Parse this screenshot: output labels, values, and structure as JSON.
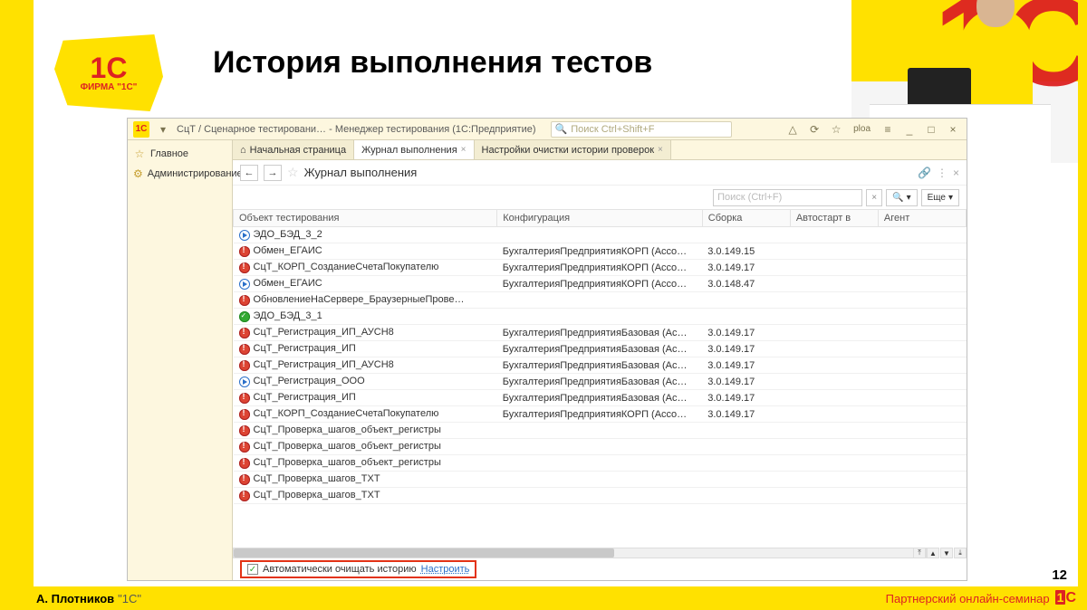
{
  "slide": {
    "title": "История выполнения тестов",
    "number": "12",
    "author_name": "А. Плотников",
    "author_org": "\"1С\"",
    "seminar": "Партнерский онлайн-семинар",
    "logo_text_big": "1С",
    "logo_text_small": "ФИРМА \"1С\""
  },
  "app": {
    "title": "СцТ / Сценарное тестировани…  - Менеджер тестирования (1С:Предприятие)",
    "search_placeholder": "Поиск Ctrl+Shift+F",
    "user_label": "ploa",
    "sidebar": {
      "main": "Главное",
      "admin": "Администрирование"
    },
    "tabs": {
      "start": "Начальная страница",
      "journal": "Журнал выполнения",
      "settings": "Настройки очистки истории проверок"
    },
    "header": {
      "title": "Журнал выполнения",
      "search_placeholder": "Поиск (Ctrl+F)",
      "more_btn": "Еще"
    },
    "columns": {
      "object": "Объект тестирования",
      "config": "Конфигурация",
      "build": "Сборка",
      "autostart": "Автостарт в",
      "agent": "Агент"
    },
    "rows": [
      {
        "status": "play",
        "object": "ЭДО_БЭД_3_2",
        "config": "",
        "build": ""
      },
      {
        "status": "red",
        "object": "Обмен_ЕГАИС",
        "config": "БухгалтерияПредприятияКОРП (Acco…",
        "build": "3.0.149.15"
      },
      {
        "status": "red",
        "object": "СцТ_КОРП_СозданиеСчетаПокупателю",
        "config": "БухгалтерияПредприятияКОРП (Acco…",
        "build": "3.0.149.17"
      },
      {
        "status": "play",
        "object": "Обмен_ЕГАИС",
        "config": "БухгалтерияПредприятияКОРП (Acco…",
        "build": "3.0.148.47"
      },
      {
        "status": "red",
        "object": "ОбновлениеНаСервере_БраузерныеПрове…",
        "config": "",
        "build": ""
      },
      {
        "status": "green",
        "object": "ЭДО_БЭД_3_1",
        "config": "",
        "build": ""
      },
      {
        "status": "red",
        "object": "СцТ_Регистрация_ИП_АУСН8",
        "config": "БухгалтерияПредприятияБазовая (Ac…",
        "build": "3.0.149.17"
      },
      {
        "status": "red",
        "object": "СцТ_Регистрация_ИП",
        "config": "БухгалтерияПредприятияБазовая (Ac…",
        "build": "3.0.149.17"
      },
      {
        "status": "red",
        "object": "СцТ_Регистрация_ИП_АУСН8",
        "config": "БухгалтерияПредприятияБазовая (Ac…",
        "build": "3.0.149.17"
      },
      {
        "status": "play",
        "object": "СцТ_Регистрация_ООО",
        "config": "БухгалтерияПредприятияБазовая (Ac…",
        "build": "3.0.149.17"
      },
      {
        "status": "red",
        "object": "СцТ_Регистрация_ИП",
        "config": "БухгалтерияПредприятияБазовая (Ac…",
        "build": "3.0.149.17"
      },
      {
        "status": "red",
        "object": "СцТ_КОРП_СозданиеСчетаПокупателю",
        "config": "БухгалтерияПредприятияКОРП (Acco…",
        "build": "3.0.149.17"
      },
      {
        "status": "red",
        "object": "СцТ_Проверка_шагов_объект_регистры",
        "config": "",
        "build": ""
      },
      {
        "status": "red",
        "object": "СцТ_Проверка_шагов_объект_регистры",
        "config": "",
        "build": ""
      },
      {
        "status": "red",
        "object": "СцТ_Проверка_шагов_объект_регистры",
        "config": "",
        "build": ""
      },
      {
        "status": "red",
        "object": "СцТ_Проверка_шагов_ТХТ",
        "config": "",
        "build": ""
      },
      {
        "status": "red",
        "object": "СцТ_Проверка_шагов_ТХТ",
        "config": "",
        "build": ""
      }
    ],
    "footer": {
      "checkbox_label": "Автоматически очищать историю",
      "link": "Настроить"
    }
  }
}
